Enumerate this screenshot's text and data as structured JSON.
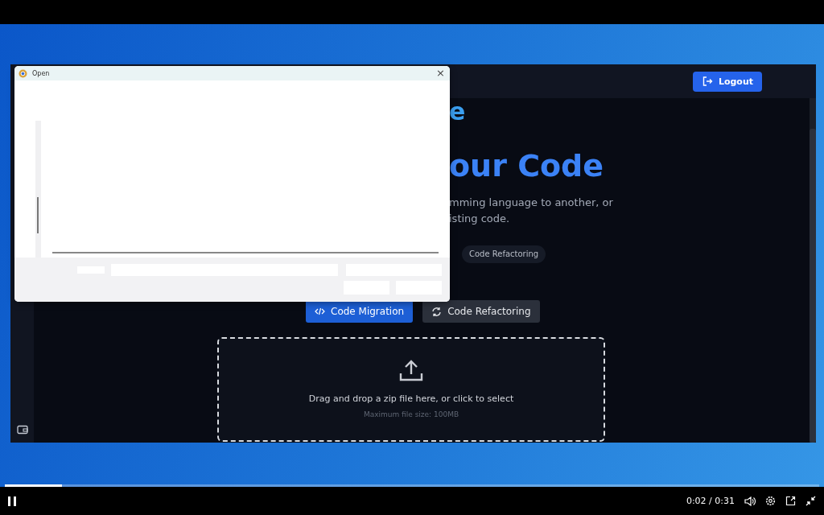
{
  "player": {
    "playing": true,
    "time": "0:02 / 0:31",
    "progress": {
      "level": 0.07
    }
  },
  "app": {
    "logout": "Logout",
    "title_fragment": "e",
    "heading_fragment": "our Code",
    "description_lines": [
      "mming language to another, or",
      "isting code."
    ],
    "chips": [
      "Code Refactoring"
    ],
    "modes": [
      {
        "label": "Code Migration",
        "selected": true,
        "kind": "migration"
      },
      {
        "label": "Code Refactoring",
        "selected": false,
        "kind": "refactoring"
      }
    ],
    "dropzone": {
      "prompt": "Drag and drop a zip file here, or click to select",
      "hint": "Maximum file size: 100MB"
    }
  },
  "dialog": {
    "title": "Open",
    "close": "×"
  }
}
